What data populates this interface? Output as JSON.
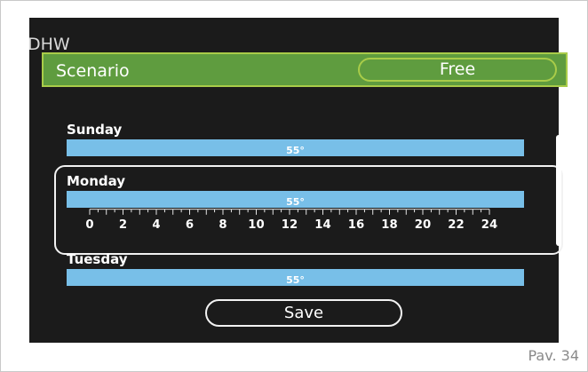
{
  "screen": {
    "title": "DHW",
    "scenario": {
      "label": "Scenario",
      "value": "Free"
    },
    "days": [
      {
        "name": "Sunday",
        "temperature": "55°"
      },
      {
        "name": "Monday",
        "temperature": "55°"
      },
      {
        "name": "Tuesday",
        "temperature": "55°"
      }
    ],
    "timeline_labels": [
      "0",
      "2",
      "4",
      "6",
      "8",
      "10",
      "12",
      "14",
      "16",
      "18",
      "20",
      "22",
      "24"
    ],
    "save_label": "Save"
  },
  "page_label": "Pav. 34",
  "colors": {
    "screen_background": "#1b1b1b",
    "scenario_green": "#5f9c3f",
    "scenario_border": "#a9cc49",
    "temperature_bar": "#78bfe8"
  }
}
